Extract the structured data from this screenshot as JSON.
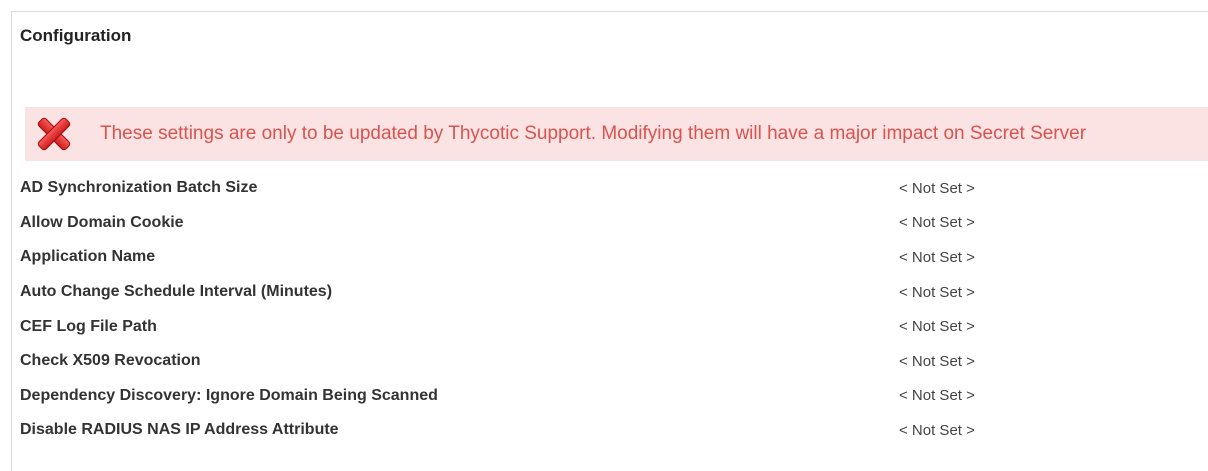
{
  "section": {
    "title": "Configuration"
  },
  "warning": {
    "icon": "error-x-icon",
    "text": "These settings are only to be updated by Thycotic Support. Modifying them will have a major impact on Secret Server",
    "color": "#d9534f",
    "background": "#fbe3e3"
  },
  "settings": [
    {
      "label": "AD Synchronization Batch Size",
      "value": "< Not Set >"
    },
    {
      "label": "Allow Domain Cookie",
      "value": "< Not Set >"
    },
    {
      "label": "Application Name",
      "value": "< Not Set >"
    },
    {
      "label": "Auto Change Schedule Interval (Minutes)",
      "value": "< Not Set >"
    },
    {
      "label": "CEF Log File Path",
      "value": "< Not Set >"
    },
    {
      "label": "Check X509 Revocation",
      "value": "< Not Set >"
    },
    {
      "label": "Dependency Discovery: Ignore Domain Being Scanned",
      "value": "< Not Set >"
    },
    {
      "label": "Disable RADIUS NAS IP Address Attribute",
      "value": "< Not Set >"
    }
  ]
}
